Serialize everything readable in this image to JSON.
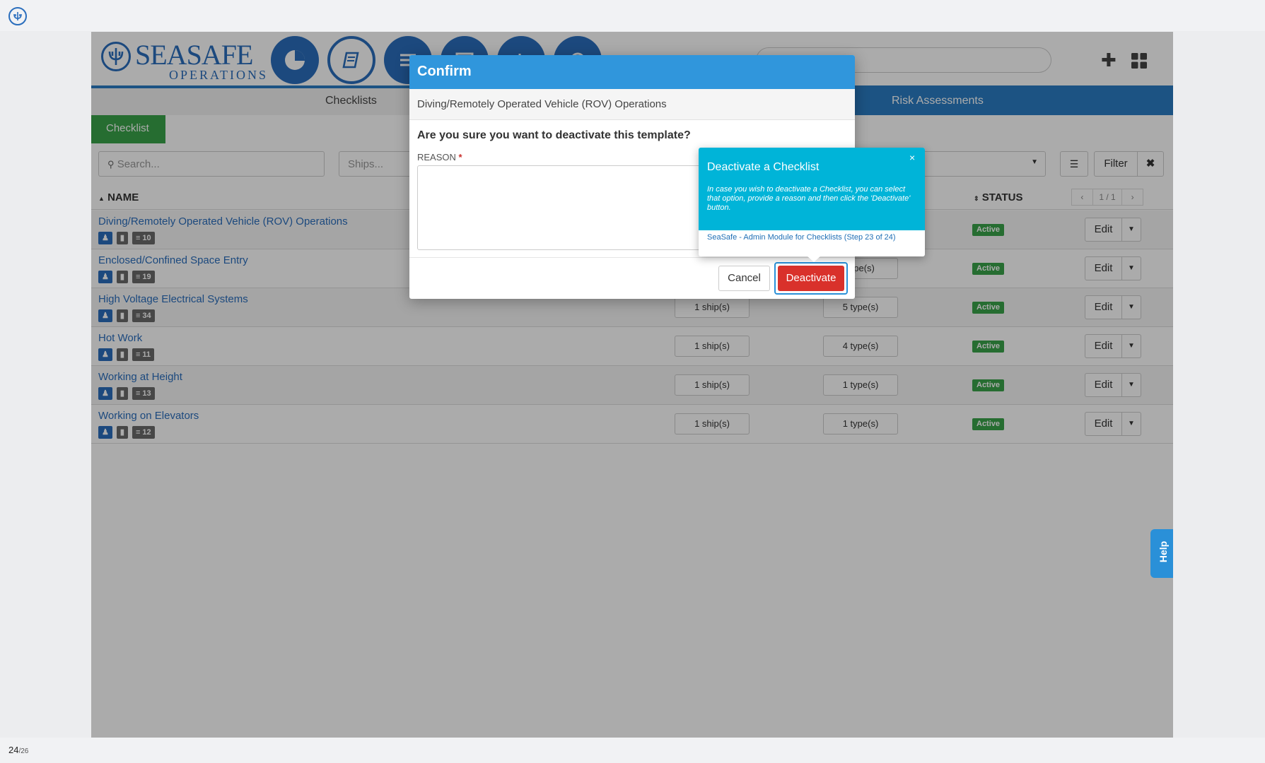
{
  "viewer": {
    "page_current": "24",
    "page_total": "/26"
  },
  "brand": {
    "name": "SEASAFE",
    "subtitle": "OPERATIONS"
  },
  "subnav": {
    "checklists": "Checklists",
    "risk_assessments": "Risk Assessments"
  },
  "tabs": {
    "checklist": "Checklist"
  },
  "filters": {
    "search_placeholder": "Search...",
    "ships_placeholder": "Ships...",
    "filter_label": "Filter"
  },
  "table": {
    "name_header": "NAME",
    "status_header": "STATUS",
    "pager_prev": "‹",
    "pager_text": "1 / 1",
    "pager_next": "›",
    "edit_label": "Edit",
    "rows": [
      {
        "name": "Diving/Remotely Operated Vehicle (ROV) Operations",
        "count": "10",
        "ships": "",
        "types": "",
        "status": "Active"
      },
      {
        "name": "Enclosed/Confined Space Entry",
        "count": "19",
        "ships": "",
        "types": "type(s)",
        "status": "Active"
      },
      {
        "name": "High Voltage Electrical Systems",
        "count": "34",
        "ships": "1 ship(s)",
        "types": "5 type(s)",
        "status": "Active"
      },
      {
        "name": "Hot Work",
        "count": "11",
        "ships": "1 ship(s)",
        "types": "4 type(s)",
        "status": "Active"
      },
      {
        "name": "Working at Height",
        "count": "13",
        "ships": "1 ship(s)",
        "types": "1 type(s)",
        "status": "Active"
      },
      {
        "name": "Working on Elevators",
        "count": "12",
        "ships": "1 ship(s)",
        "types": "1 type(s)",
        "status": "Active"
      }
    ]
  },
  "modal": {
    "title": "Confirm",
    "subtitle": "Diving/Remotely Operated Vehicle (ROV) Operations",
    "question": "Are you sure you want to deactivate this template?",
    "reason_label": "REASON",
    "required_mark": "*",
    "cancel_label": "Cancel",
    "deactivate_label": "Deactivate"
  },
  "tour": {
    "close": "×",
    "title": "Deactivate a Checklist",
    "text": "In case you wish to deactivate a Checklist, you can select that option, provide a reason and then click the 'Deactivate' button.",
    "footer": "SeaSafe - Admin Module for Checklists (Step 23 of 24)"
  },
  "help": {
    "label": "Help"
  },
  "colors": {
    "brand_blue": "#2a6ebd",
    "active_green": "#3aa34a",
    "modal_header": "#3096dc",
    "tour_cyan": "#00b4d8",
    "danger_red": "#d9312b"
  }
}
